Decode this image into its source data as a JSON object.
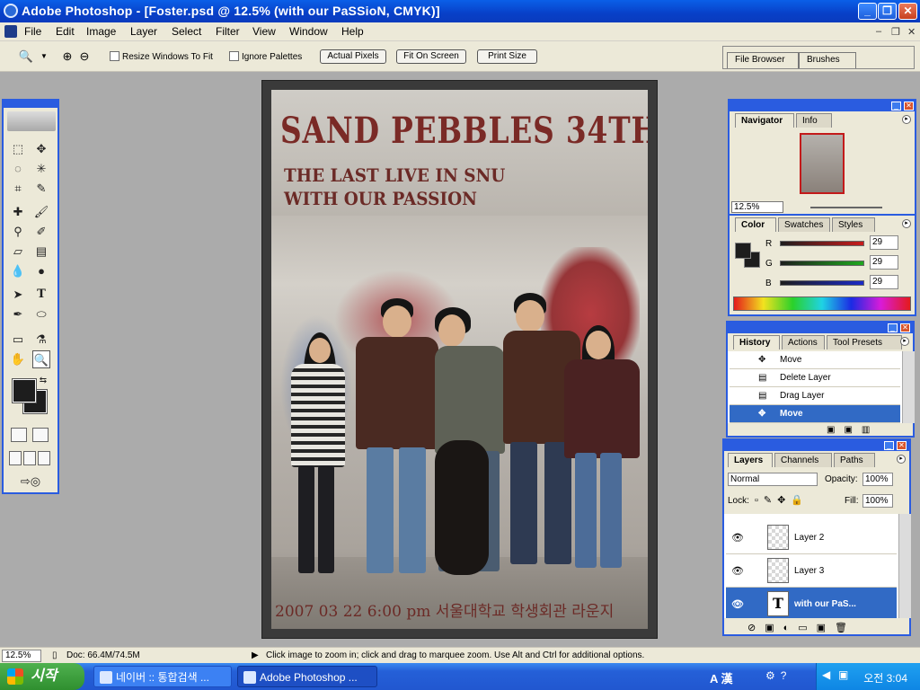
{
  "window": {
    "title": "Adobe Photoshop - [Foster.psd @ 12.5% (with our PaSSioN, CMYK)]"
  },
  "menu": {
    "items": [
      "File",
      "Edit",
      "Image",
      "Layer",
      "Select",
      "Filter",
      "View",
      "Window",
      "Help"
    ]
  },
  "options_bar": {
    "resize_windows": "Resize Windows To Fit",
    "ignore_palettes": "Ignore Palettes",
    "actual_pixels": "Actual Pixels",
    "fit_on_screen": "Fit On Screen",
    "print_size": "Print Size",
    "well_tabs": [
      "File Browser",
      "Brushes"
    ]
  },
  "poster": {
    "headline": "SAND PEBBLES 34TH",
    "subtitle_line1": "THE LAST LIVE IN SNU",
    "subtitle_line2": "WITH OUR PASSION",
    "date_line": "2007 03 22 6:00 pm 서울대학교 학생회관 라운지"
  },
  "navigator": {
    "tabs": [
      "Navigator",
      "Info"
    ],
    "zoom": "12.5%"
  },
  "color_panel": {
    "tabs": [
      "Color",
      "Swatches",
      "Styles"
    ],
    "channels": [
      {
        "label": "R",
        "value": "29",
        "color": "#c81c1c"
      },
      {
        "label": "G",
        "value": "29",
        "color": "#1fa81f"
      },
      {
        "label": "B",
        "value": "29",
        "color": "#1c2ac8"
      }
    ]
  },
  "history_panel": {
    "tabs": [
      "History",
      "Actions",
      "Tool Presets"
    ],
    "items": [
      "Move",
      "Delete Layer",
      "Drag Layer",
      "Move"
    ]
  },
  "layers_panel": {
    "tabs": [
      "Layers",
      "Channels",
      "Paths"
    ],
    "blend_mode": "Normal",
    "opacity_label": "Opacity:",
    "opacity": "100%",
    "lock_label": "Lock:",
    "fill_label": "Fill:",
    "fill": "100%",
    "layers": [
      "Layer 2",
      "Layer 3",
      "with our PaS..."
    ]
  },
  "status_bar": {
    "zoom": "12.5%",
    "doc": "Doc: 66.4M/74.5M",
    "hint": "Click image to zoom in; click and drag to marquee zoom.  Use Alt and Ctrl for additional options."
  },
  "taskbar": {
    "start": "시작",
    "tasks": [
      "네이버 :: 통합검색 ...",
      "Adobe Photoshop ..."
    ],
    "ime": "A 漢",
    "clock": "오전 3:04"
  }
}
